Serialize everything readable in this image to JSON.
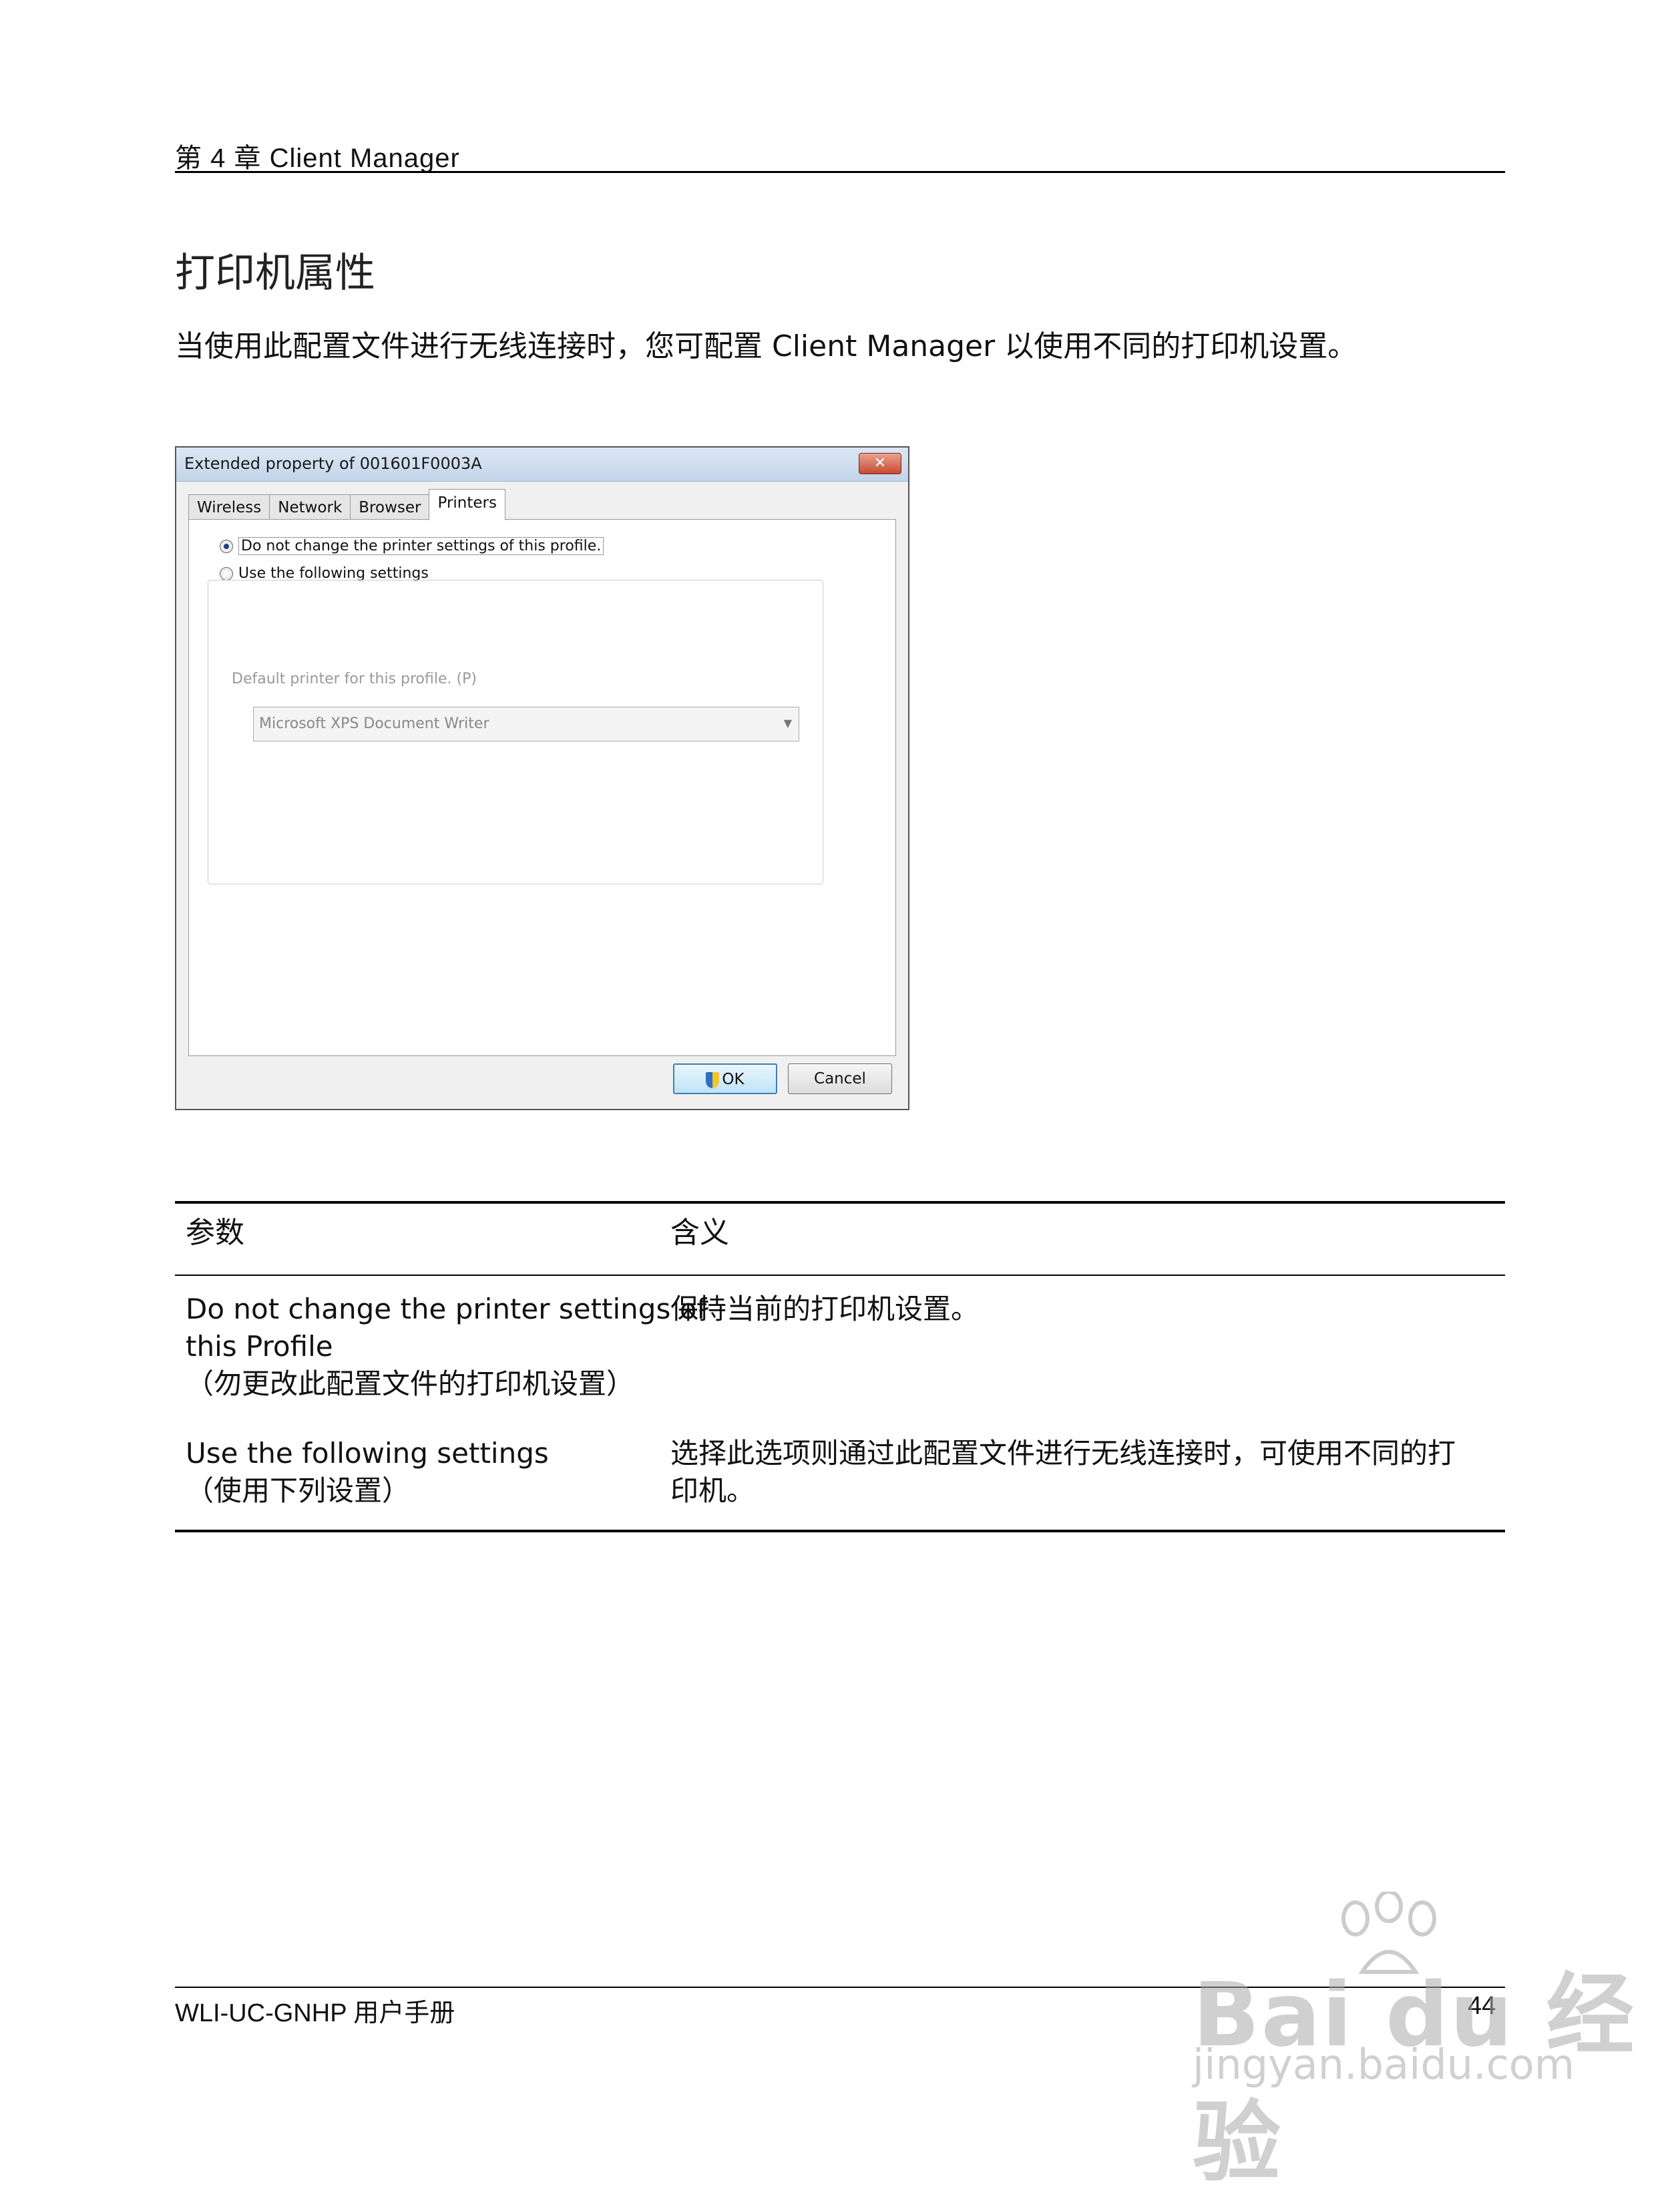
{
  "header": {
    "running_head": "第 4 章 Client Manager"
  },
  "section": {
    "title": "打印机属性",
    "intro": "当使用此配置文件进行无线连接时，您可配置 Client Manager 以使用不同的打印机设置。"
  },
  "dialog": {
    "title": "Extended property of 001601F0003A",
    "close_label": "✕",
    "tabs": [
      {
        "label": "Wireless"
      },
      {
        "label": "Network"
      },
      {
        "label": "Browser"
      },
      {
        "label": "Printers"
      }
    ],
    "active_tab": "Printers",
    "options": {
      "no_change": "Do not change the printer settings of this profile.",
      "use_following": "Use the following settings",
      "selected": "no_change"
    },
    "default_printer_label": "Default printer for this profile. (P)",
    "printer_value": "Microsoft XPS Document Writer",
    "ok_label": "OK",
    "cancel_label": "Cancel"
  },
  "table": {
    "headers": [
      "参数",
      "含义"
    ],
    "rows": [
      {
        "param_en": "Do not change the printer settings of this Profile",
        "param_en_line1": "Do not change the printer settings of",
        "param_en_line2": "this Profile",
        "param_cn": "（勿更改此配置文件的打印机设置）",
        "meaning": "保持当前的打印机设置。"
      },
      {
        "param_en": "Use the following settings",
        "param_cn": "（使用下列设置）",
        "meaning_line1": "选择此选项则通过此配置文件进行无线连接时，可使用不同的打",
        "meaning_line2": "印机。"
      }
    ]
  },
  "footer": {
    "manual_name": "WLI-UC-GNHP 用户手册",
    "page_number": "44"
  },
  "watermark": {
    "brand": "Bai du 经验",
    "url": "jingyan.baidu.com"
  }
}
